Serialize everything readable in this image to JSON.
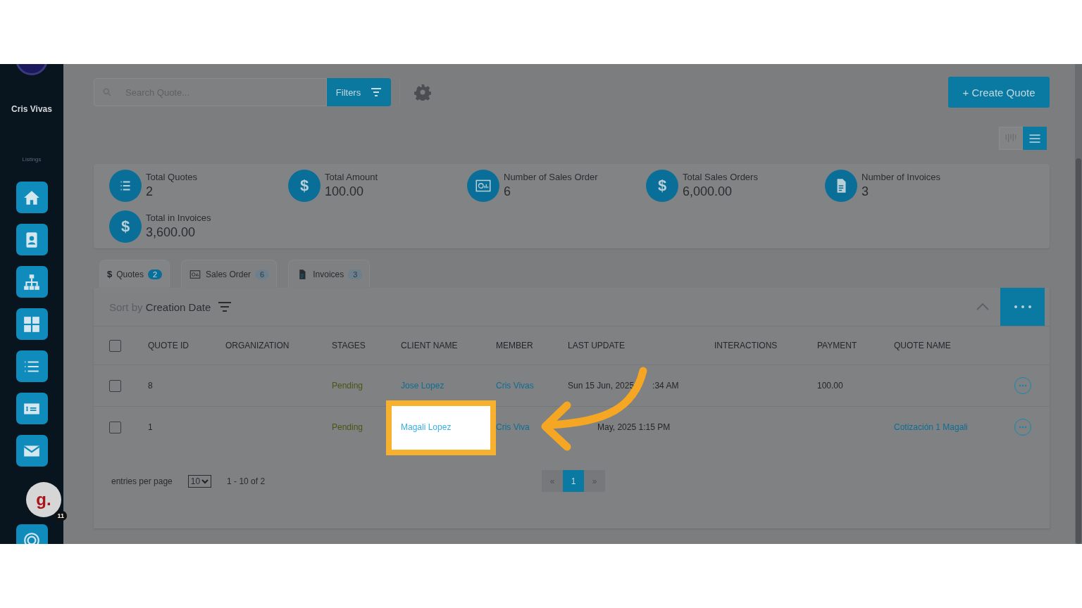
{
  "sidebar": {
    "user_name": "Cris Vivas",
    "section_label": "Listings",
    "app_logo": "g.",
    "notification_count": "11"
  },
  "search": {
    "placeholder": "Search Quote..."
  },
  "filters_button": "Filters",
  "create_button": "+ Create Quote",
  "view_toggle": [
    {
      "kind": "board",
      "selected": false
    },
    {
      "kind": "list",
      "selected": true
    }
  ],
  "stats": [
    {
      "kind": "list",
      "label": "Total Quotes",
      "value": "2"
    },
    {
      "kind": "glyph",
      "icon_text": "$",
      "label": "Total Amount",
      "value": "100.00"
    },
    {
      "kind": "bill",
      "label": "Number of Sales Order",
      "value": "6"
    },
    {
      "kind": "glyph",
      "icon_text": "$",
      "label": "Total Sales Orders",
      "value": "6,000.00"
    },
    {
      "kind": "doc",
      "label": "Number of Invoices",
      "value": "3"
    },
    {
      "kind": "glyph",
      "icon_text": "$",
      "label": "Total in Invoices",
      "value": "3,600.00"
    }
  ],
  "tabs": [
    {
      "kind": "glyph",
      "icon_text": "$",
      "label": "Quotes",
      "count": "2",
      "selected": true
    },
    {
      "kind": "bill",
      "label": "Sales Order",
      "count": "6",
      "selected": false
    },
    {
      "kind": "doc",
      "label": "Invoices",
      "count": "3",
      "selected": false
    }
  ],
  "sort": {
    "prefix": "Sort by",
    "field": "Creation Date"
  },
  "table": {
    "select_all": {
      "checked": false
    },
    "columns": [
      "QUOTE ID",
      "ORGANIZATION",
      "STAGES",
      "CLIENT NAME",
      "MEMBER",
      "LAST UPDATE",
      "INTERACTIONS",
      "PAYMENT",
      "QUOTE NAME"
    ],
    "rows": [
      {
        "checked": false,
        "quote_id": "8",
        "stage": "Pending",
        "client": "Jose Lopez",
        "member": "Cris Vivas",
        "last_update": "Sun 15 Jun, 2025",
        "last_update_tail": ":34 AM",
        "payment": "100.00",
        "highlighted": false
      },
      {
        "checked": false,
        "quote_id": "1",
        "stage": "Pending",
        "client": "Magali Lopez",
        "member": "Cris Viva",
        "last_update_tail": "May, 2025 1:15 PM",
        "quote_name": "Cotización 1 Magali",
        "highlighted": true
      }
    ]
  },
  "footer": {
    "entries_label": "entries per page",
    "per_page": "10",
    "range": "1 - 10 of 2"
  },
  "pagination": [
    {
      "label": "«",
      "selected": false
    },
    {
      "label": "1",
      "selected": true
    },
    {
      "label": "»",
      "selected": false
    }
  ]
}
